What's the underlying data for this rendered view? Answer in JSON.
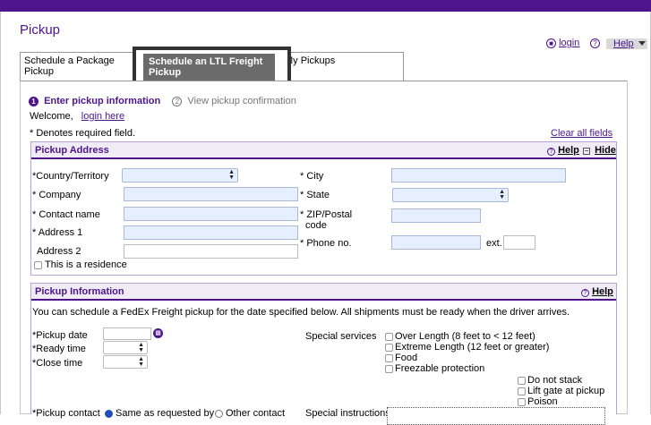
{
  "page": {
    "title": "Pickup"
  },
  "util": {
    "login_label": "login",
    "help_label": "Help"
  },
  "tabs": [
    {
      "label": "Schedule a Package Pickup"
    },
    {
      "label": "Schedule an LTL Freight Pickup"
    },
    {
      "label": "My Pickups"
    }
  ],
  "steps": {
    "step1_num": "1",
    "step1": "Enter pickup information",
    "step2_num": "2",
    "step2": "View pickup confirmation"
  },
  "welcome": {
    "text": "Welcome,",
    "link": "login here"
  },
  "required_note": "* Denotes required field.",
  "clear_all": "Clear all fields",
  "address": {
    "title": "Pickup Address",
    "help": "Help",
    "hide": "Hide",
    "country_label": "*Country/Territory",
    "company_label": "* Company",
    "contact_label": "* Contact name",
    "address1_label": "* Address 1",
    "address2_label": "Address 2",
    "residence_label": "This is a residence",
    "city_label": "* City",
    "state_label": "* State",
    "zip_label_1": "* ZIP/Postal",
    "zip_label_2": "code",
    "phone_label": "* Phone no.",
    "ext_label": "ext."
  },
  "info": {
    "title": "Pickup Information",
    "help": "Help",
    "description": "You can schedule a FedEx Freight pickup for the date specified below. All shipments must be ready when the driver arrives.",
    "pickup_date_label": "*Pickup date",
    "ready_time_label": "*Ready time",
    "close_time_label": "*Close time",
    "special_services_label": "Special services",
    "services": [
      "Over Length (8 feet to < 12 feet)",
      "Extreme Length (12 feet or greater)",
      "Food",
      "Freezable protection"
    ],
    "extra_services": [
      "Do not stack",
      "Lift gate at pickup",
      "Poison"
    ],
    "pickup_contact_label": "*Pickup contact",
    "same_as_label": "Same as requested by",
    "other_contact_label": "Other contact",
    "special_instructions_label": "Special instructions"
  },
  "colors": {
    "brand": "#4d148c",
    "field_bg": "#e6efff"
  }
}
